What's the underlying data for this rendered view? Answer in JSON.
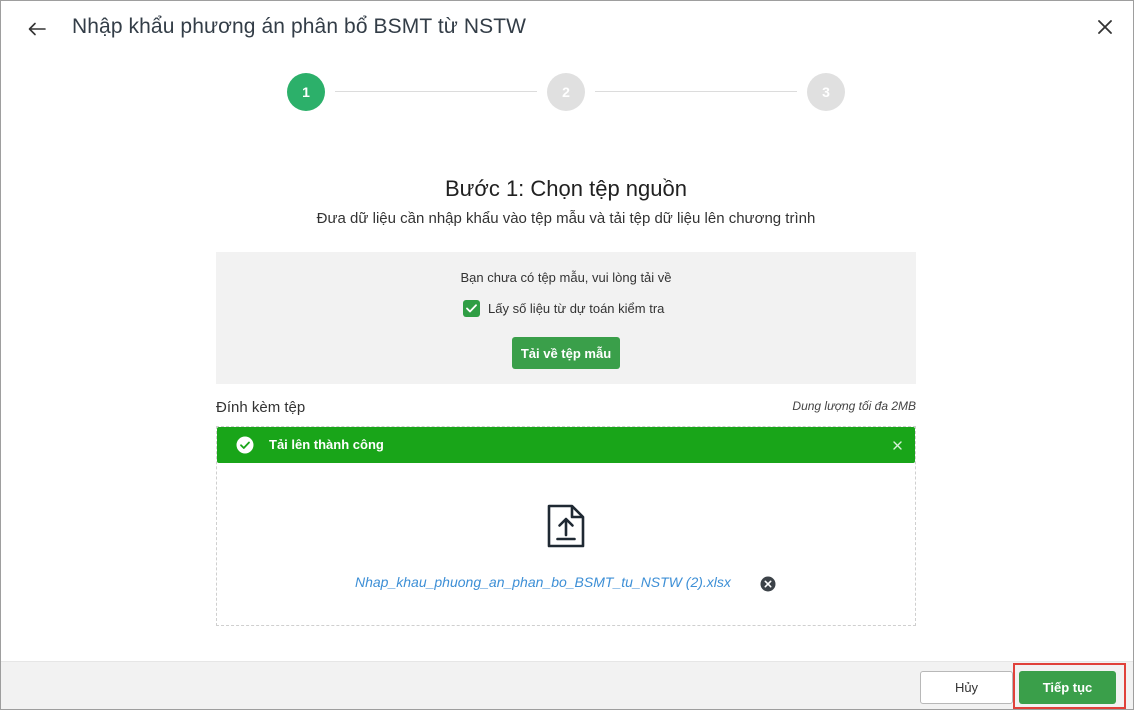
{
  "dialog": {
    "title": "Nhập khẩu phương án phân bổ BSMT từ NSTW",
    "back_icon": "arrow-left-icon",
    "close_icon": "close-icon"
  },
  "stepper": {
    "steps": [
      {
        "number": "1",
        "state": "active"
      },
      {
        "number": "2",
        "state": "inactive"
      },
      {
        "number": "3",
        "state": "inactive"
      }
    ],
    "active_color": "#2cb06a",
    "inactive_color": "#e0e0e0"
  },
  "step": {
    "title": "Bước 1: Chọn tệp nguồn",
    "description": "Đưa dữ liệu cần nhập khẩu vào tệp mẫu và tải tệp dữ liệu lên chương trình"
  },
  "template": {
    "note": "Bạn chưa có tệp mẫu, vui lòng tải về",
    "checkbox_label": "Lấy số liệu từ dự toán kiểm tra",
    "checkbox_checked": true,
    "download_label": "Tải về tệp mẫu"
  },
  "attachment": {
    "label": "Đính kèm tệp",
    "size_note": "Dung lượng tối đa 2MB",
    "success_message": "Tải lên thành công",
    "success_color": "#19a519",
    "file_name": "Nhap_khau_phuong_an_phan_bo_BSMT_tu_NSTW (2).xlsx",
    "file_icon": "file-upload-icon"
  },
  "footer": {
    "cancel_label": "Hủy",
    "next_label": "Tiếp tục",
    "primary_color": "#3a9f4a",
    "highlight_color": "#e0413a"
  }
}
